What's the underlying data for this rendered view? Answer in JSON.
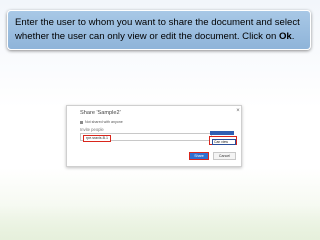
{
  "instruction": {
    "text_before": "Enter the user to whom you want to share the document and select whether the user can only view or edit the document. Click on ",
    "bold_word": "Ok",
    "text_after": "."
  },
  "dialog": {
    "title": "Share 'Sample2'",
    "shared_status": "Not shared with anyone",
    "invite_label": "Invite people",
    "invitee_chip": "rpe.sravis.B.1",
    "permission_value": "Can view",
    "share_label": "Share",
    "cancel_label": "Cancel",
    "close_glyph": "×"
  },
  "colors": {
    "callout_bg": "#9dbfe3",
    "highlight_red": "#d9261c",
    "primary_blue": "#2f6fd0"
  }
}
